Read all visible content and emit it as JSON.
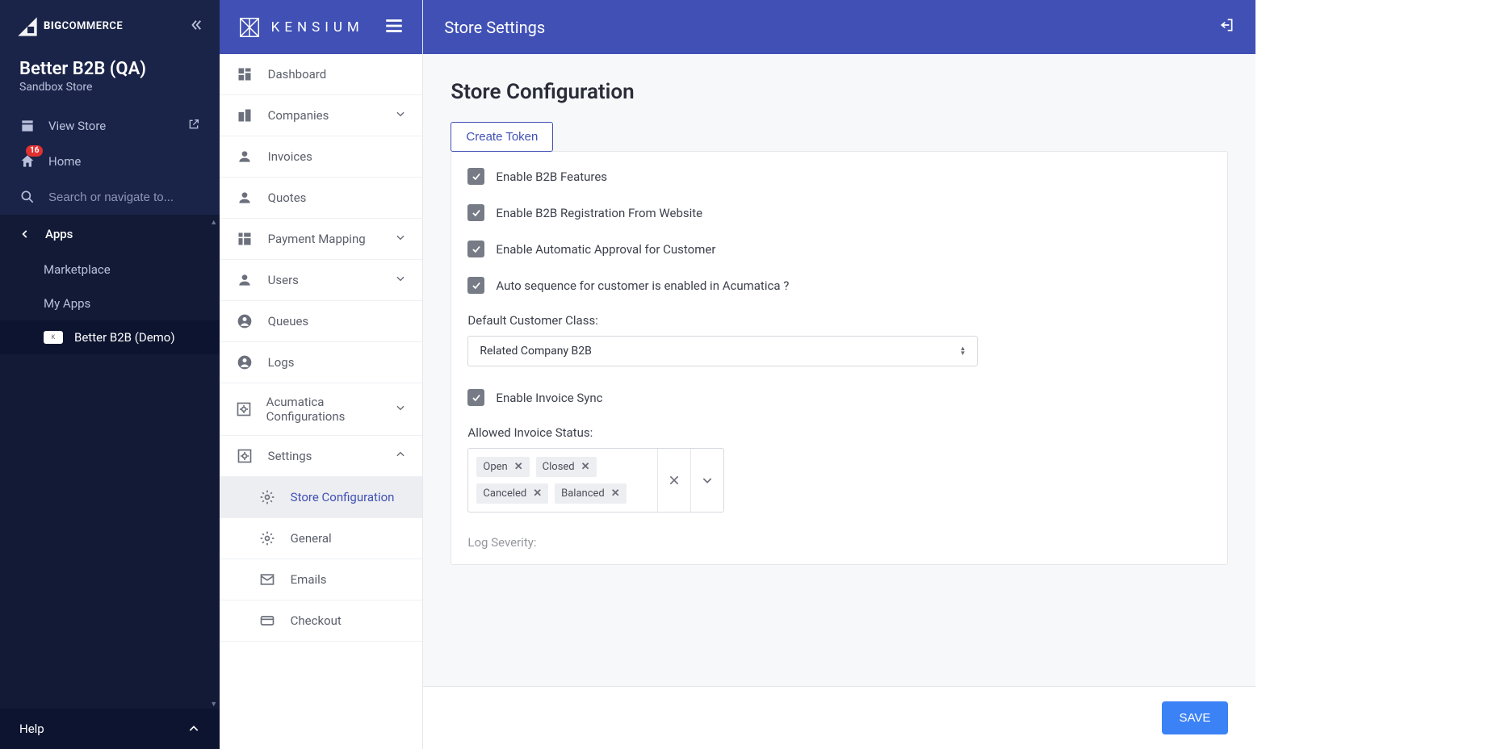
{
  "bc": {
    "brand_prefix": "BIG",
    "brand_suffix": "COMMERCE",
    "store_name": "Better B2B (QA)",
    "store_sub": "Sandbox Store",
    "view_store": "View Store",
    "home": "Home",
    "home_badge": "16",
    "search_placeholder": "Search or navigate to...",
    "apps": "Apps",
    "marketplace": "Marketplace",
    "my_apps": "My Apps",
    "active_app": "Better B2B (Demo)",
    "help": "Help"
  },
  "kensium": {
    "brand": "KENSIUM",
    "nav": {
      "dashboard": "Dashboard",
      "companies": "Companies",
      "invoices": "Invoices",
      "quotes": "Quotes",
      "payment_mapping": "Payment Mapping",
      "users": "Users",
      "queues": "Queues",
      "logs": "Logs",
      "acumatica": "Acumatica Configurations",
      "settings": "Settings",
      "store_config": "Store Configuration",
      "general": "General",
      "emails": "Emails",
      "checkout": "Checkout"
    }
  },
  "page": {
    "header": "Store Settings",
    "title": "Store Configuration",
    "create_token": "Create Token",
    "chk_b2b": "Enable B2B Features",
    "chk_reg": "Enable B2B Registration From Website",
    "chk_auto_approve": "Enable Automatic Approval for Customer",
    "chk_auto_seq": "Auto sequence for customer is enabled in Acumatica ?",
    "default_class_label": "Default Customer Class:",
    "default_class_value": "Related Company B2B",
    "chk_invoice_sync": "Enable Invoice Sync",
    "allowed_status_label": "Allowed Invoice Status:",
    "chips": {
      "open": "Open",
      "closed": "Closed",
      "canceled": "Canceled",
      "balanced": "Balanced"
    },
    "log_severity_label": "Log Severity:",
    "save": "SAVE"
  }
}
